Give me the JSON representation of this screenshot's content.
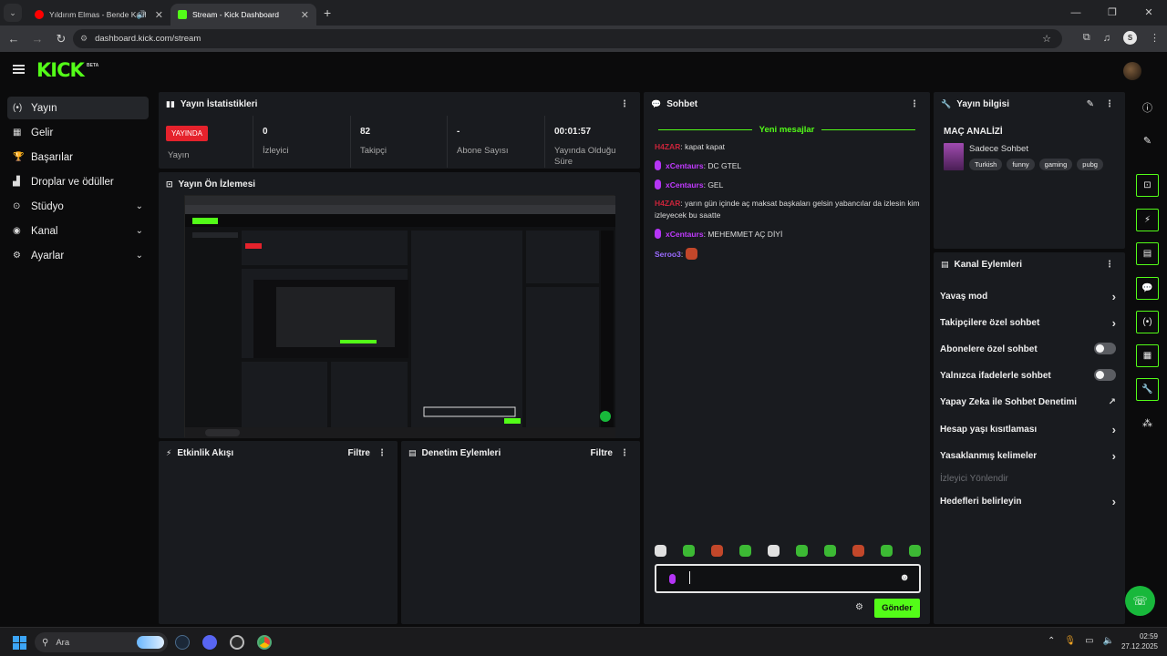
{
  "browser": {
    "tabs": [
      {
        "title": "Yıldırım Elmas - Bende Katil"
      },
      {
        "title": "Stream - Kick Dashboard"
      }
    ],
    "url": "dashboard.kick.com/stream",
    "profile_initial": "S"
  },
  "app": {
    "logo": "KICK",
    "beta": "BETA"
  },
  "sidebar": {
    "items": [
      {
        "label": "Yayın",
        "icon": "broadcast-icon"
      },
      {
        "label": "Gelir",
        "icon": "revenue-icon"
      },
      {
        "label": "Başarılar",
        "icon": "trophy-icon"
      },
      {
        "label": "Droplar ve ödüller",
        "icon": "gift-icon"
      },
      {
        "label": "Stüdyo",
        "icon": "studio-icon"
      },
      {
        "label": "Kanal",
        "icon": "channel-icon"
      },
      {
        "label": "Ayarlar",
        "icon": "gear-icon"
      }
    ]
  },
  "stats": {
    "title": "Yayın İstatistikleri",
    "live_badge": "YAYINDA",
    "items": [
      {
        "value": "",
        "label": "Yayın"
      },
      {
        "value": "0",
        "label": "İzleyici"
      },
      {
        "value": "82",
        "label": "Takipçi"
      },
      {
        "value": "-",
        "label": "Abone Sayısı"
      },
      {
        "value": "00:01:57",
        "label": "Yayında Olduğu Süre"
      }
    ]
  },
  "preview": {
    "title": "Yayın Ön İzlemesi"
  },
  "activity": {
    "title": "Etkinlik Akışı",
    "filter": "Filtre"
  },
  "moderation": {
    "title": "Denetim Eylemleri",
    "filter": "Filtre"
  },
  "chat": {
    "title": "Sohbet",
    "new_messages": "Yeni mesajlar",
    "messages": [
      {
        "user": "H4ZAR",
        "text": "kapat kapat"
      },
      {
        "user": "xCentaurs",
        "text": "DC GTEL"
      },
      {
        "user": "xCentaurs",
        "text": "GEL"
      },
      {
        "user": "H4ZAR",
        "text": "yarın gün içinde aç maksat başkaları gelsin yabancılar da izlesin kim izleyecek bu saatte"
      },
      {
        "user": "xCentaurs",
        "text": "MEHEMMET AÇ DİYİ"
      },
      {
        "user": "Seroo3",
        "text": ""
      }
    ],
    "send_label": "Gönder"
  },
  "stream_info": {
    "title": "Yayın bilgisi",
    "stream_title": "MAÇ ANALİZİ",
    "category": "Sadece Sohbet",
    "tags": [
      "Turkish",
      "funny",
      "gaming",
      "pubg"
    ]
  },
  "channel_actions": {
    "title": "Kanal Eylemleri",
    "items": [
      {
        "label": "Yavaş mod",
        "control": "chevron"
      },
      {
        "label": "Takipçilere özel sohbet",
        "control": "chevron"
      },
      {
        "label": "Abonelere özel sohbet",
        "control": "toggle"
      },
      {
        "label": "Yalnızca ifadelerle sohbet",
        "control": "toggle"
      },
      {
        "label": "Yapay Zeka ile Sohbet Denetimi",
        "control": "external"
      },
      {
        "label": "Hesap yaşı kısıtlaması",
        "control": "chevron"
      },
      {
        "label": "Yasaklanmış kelimeler",
        "control": "chevron"
      },
      {
        "label": "İzleyici Yönlendir",
        "control": "disabled"
      },
      {
        "label": "Hedefleri belirleyin",
        "control": "chevron"
      }
    ]
  },
  "taskbar": {
    "search_placeholder": "Ara",
    "time": "02:59",
    "date": "27.12.2025"
  },
  "colors": {
    "accent": "#53fc18",
    "live": "#e5222c",
    "panel": "#191b1f"
  }
}
